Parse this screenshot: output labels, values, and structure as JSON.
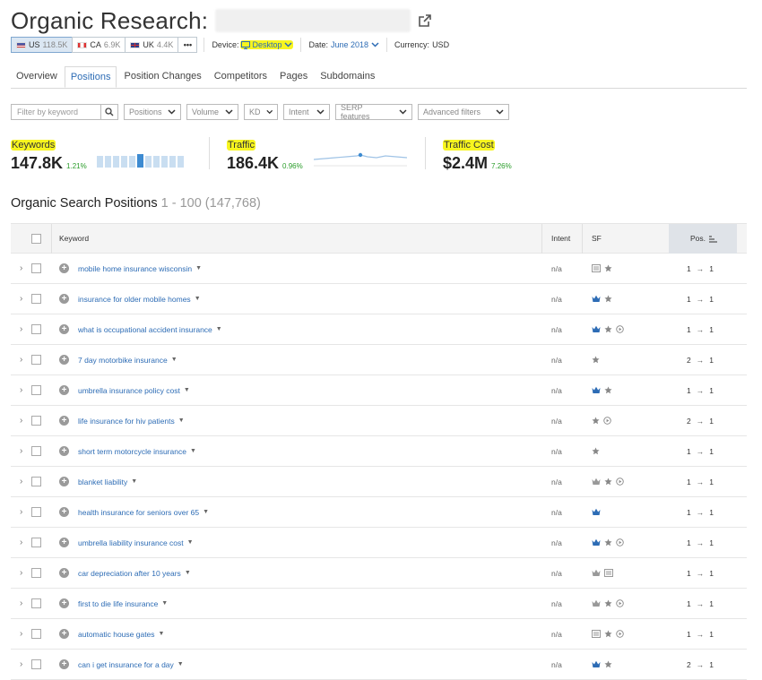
{
  "header": {
    "title": "Organic Research:"
  },
  "databases": [
    {
      "code": "US",
      "count": "118.5K",
      "flag": "us",
      "active": true
    },
    {
      "code": "CA",
      "count": "6.9K",
      "flag": "ca",
      "active": false
    },
    {
      "code": "UK",
      "count": "4.4K",
      "flag": "uk",
      "active": false
    }
  ],
  "more_label": "•••",
  "device": {
    "label": "Device:",
    "value": "Desktop"
  },
  "date": {
    "label": "Date:",
    "value": "June 2018"
  },
  "currency": {
    "label": "Currency:",
    "value": "USD"
  },
  "tabs": [
    "Overview",
    "Positions",
    "Position Changes",
    "Competitors",
    "Pages",
    "Subdomains"
  ],
  "active_tab": "Positions",
  "filters": {
    "keyword_placeholder": "Filter by keyword",
    "dropdowns": [
      "Positions",
      "Volume",
      "KD",
      "Intent",
      "SERP features",
      "Advanced filters"
    ]
  },
  "summary": {
    "keywords": {
      "label": "Keywords",
      "value": "147.8K",
      "delta": "1.21%"
    },
    "traffic": {
      "label": "Traffic",
      "value": "186.4K",
      "delta": "0.96%"
    },
    "traffic_cost": {
      "label": "Traffic Cost",
      "value": "$2.4M",
      "delta": "7.26%"
    }
  },
  "section": {
    "title": "Organic Search Positions",
    "range": "1 - 100 (147,768)"
  },
  "table": {
    "columns": {
      "keyword": "Keyword",
      "intent": "Intent",
      "sf": "SF",
      "pos": "Pos."
    },
    "rows": [
      {
        "keyword": "mobile home insurance wisconsin",
        "intent": "n/a",
        "sf": [
          "image",
          "star"
        ],
        "from": "1",
        "to": "1"
      },
      {
        "keyword": "insurance for older mobile homes",
        "intent": "n/a",
        "sf": [
          "crown",
          "star"
        ],
        "from": "1",
        "to": "1"
      },
      {
        "keyword": "what is occupational accident insurance",
        "intent": "n/a",
        "sf": [
          "crown",
          "star",
          "play"
        ],
        "from": "1",
        "to": "1"
      },
      {
        "keyword": "7 day motorbike insurance",
        "intent": "n/a",
        "sf": [
          "star"
        ],
        "from": "2",
        "to": "1"
      },
      {
        "keyword": "umbrella insurance policy cost",
        "intent": "n/a",
        "sf": [
          "crown",
          "star"
        ],
        "from": "1",
        "to": "1"
      },
      {
        "keyword": "life insurance for hiv patients",
        "intent": "n/a",
        "sf": [
          "star",
          "play"
        ],
        "from": "2",
        "to": "1"
      },
      {
        "keyword": "short term motorcycle insurance",
        "intent": "n/a",
        "sf": [
          "star"
        ],
        "from": "1",
        "to": "1"
      },
      {
        "keyword": "blanket liability",
        "intent": "n/a",
        "sf": [
          "crown-gray",
          "star",
          "play"
        ],
        "from": "1",
        "to": "1"
      },
      {
        "keyword": "health insurance for seniors over 65",
        "intent": "n/a",
        "sf": [
          "crown"
        ],
        "from": "1",
        "to": "1"
      },
      {
        "keyword": "umbrella liability insurance cost",
        "intent": "n/a",
        "sf": [
          "crown",
          "star",
          "play"
        ],
        "from": "1",
        "to": "1"
      },
      {
        "keyword": "car depreciation after 10 years",
        "intent": "n/a",
        "sf": [
          "crown-gray",
          "image"
        ],
        "from": "1",
        "to": "1"
      },
      {
        "keyword": "first to die life insurance",
        "intent": "n/a",
        "sf": [
          "crown-gray",
          "star",
          "play"
        ],
        "from": "1",
        "to": "1"
      },
      {
        "keyword": "automatic house gates",
        "intent": "n/a",
        "sf": [
          "image",
          "star",
          "play"
        ],
        "from": "1",
        "to": "1"
      },
      {
        "keyword": "can i get insurance for a day",
        "intent": "n/a",
        "sf": [
          "crown",
          "star"
        ],
        "from": "2",
        "to": "1"
      }
    ]
  },
  "colors": {
    "accent": "#2d6cb5",
    "highlight": "#f7f51f",
    "positive": "#2a9d2a",
    "crown": "#2d6cb5"
  }
}
